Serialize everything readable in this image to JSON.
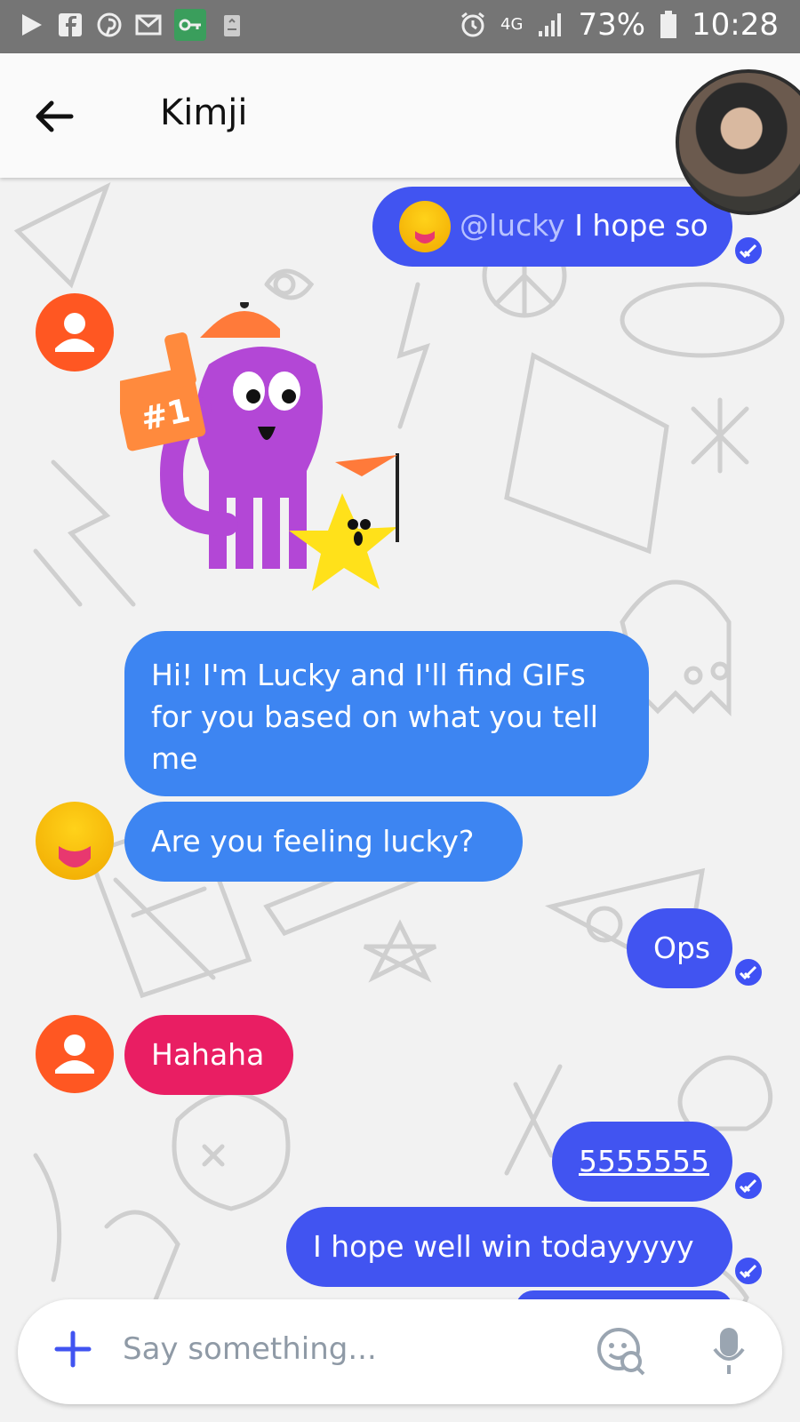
{
  "status_bar": {
    "battery": "73%",
    "time": "10:28",
    "network": "4G",
    "icons": [
      "play-icon",
      "facebook-icon",
      "pinterest-icon",
      "mail-icon",
      "key-icon",
      "recycle-icon",
      "alarm-icon",
      "network-icon",
      "signal-icon",
      "battery-icon"
    ]
  },
  "header": {
    "title": "Kimji"
  },
  "messages": [
    {
      "id": "m1",
      "direction": "outgoing",
      "mention": "@lucky",
      "text": "I hope so"
    },
    {
      "id": "m2",
      "direction": "incoming",
      "type": "sticker",
      "sticker_text": "#1"
    },
    {
      "id": "m3",
      "direction": "incoming",
      "text": "Hi! I'm Lucky and I'll find GIFs for you based on what you tell me"
    },
    {
      "id": "m4",
      "direction": "incoming",
      "text": "Are you feeling lucky?"
    },
    {
      "id": "m5",
      "direction": "outgoing",
      "text": "Ops"
    },
    {
      "id": "m6",
      "direction": "incoming",
      "text": "Hahaha"
    },
    {
      "id": "m7",
      "direction": "outgoing",
      "text": "5555555"
    },
    {
      "id": "m8",
      "direction": "outgoing",
      "text": "I hope well win todayyyyy"
    }
  ],
  "compose": {
    "placeholder": "Say something..."
  },
  "colors": {
    "outgoing": "#4154f1",
    "incoming": "#3d85f2",
    "pink": "#e91e63",
    "avatar": "#ff5722",
    "statusbar": "#757575"
  }
}
